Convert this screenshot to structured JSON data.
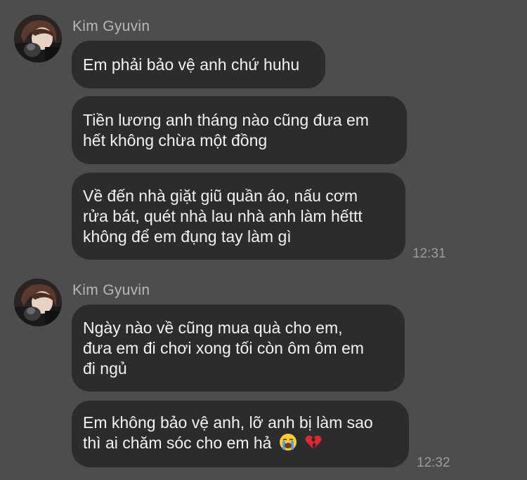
{
  "groups": [
    {
      "sender": "Kim Gyuvin",
      "time": "12:31",
      "messages": [
        {
          "lines": [
            "Em phải bảo vệ anh chứ huhu"
          ]
        },
        {
          "lines": [
            "Tiền lương anh tháng nào cũng đưa em",
            "hết không chừa một đồng"
          ]
        },
        {
          "lines": [
            "Về đến nhà giặt giũ quần áo, nấu cơm",
            "rửa bát, quét nhà lau nhà anh làm hếttt",
            "không để em đụng tay làm gì"
          ]
        }
      ]
    },
    {
      "sender": "Kim Gyuvin",
      "time": "12:32",
      "messages": [
        {
          "lines": [
            "Ngày nào về cũng mua quà cho em,",
            "đưa em đi chơi xong tối còn ôm ôm em",
            "đi ngủ"
          ]
        },
        {
          "lines": [
            "Em không bảo vệ anh, lỡ anh bị làm sao",
            "thì ai chăm sóc cho em hả"
          ],
          "emojis": [
            "loudly-crying-face",
            "broken-heart"
          ]
        }
      ]
    }
  ],
  "colors": {
    "background": "#4d4c4f",
    "bubble": "#2c2b2e",
    "text": "#f2f2f2",
    "sender": "#b7b6b9",
    "time": "#9c9b9e"
  }
}
